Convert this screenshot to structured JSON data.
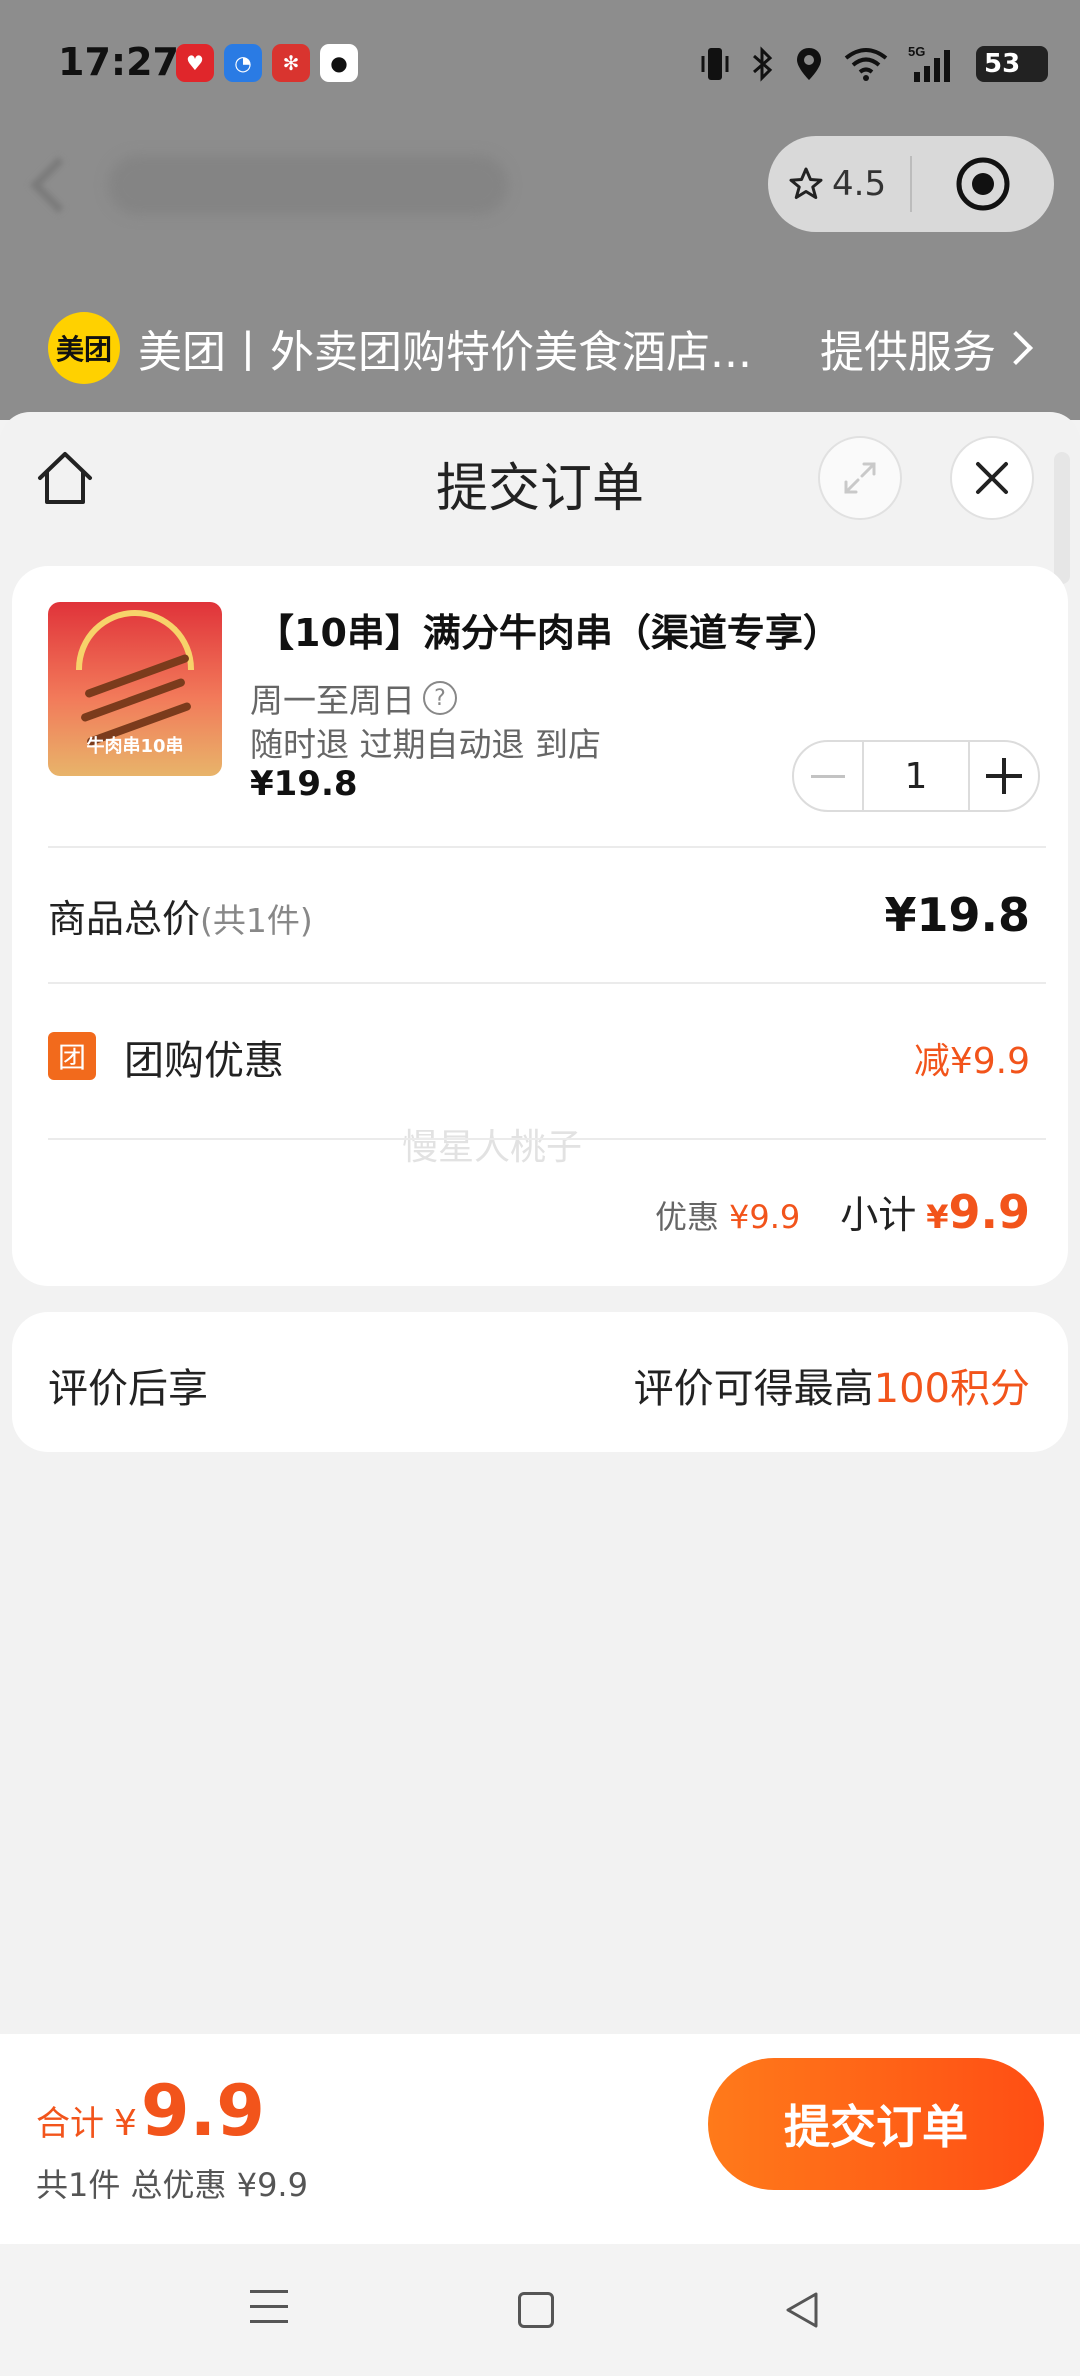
{
  "status_bar": {
    "time": "17:27",
    "network": "5G",
    "battery": "53",
    "app_icons": [
      "pinduoduo-icon",
      "app-blue-icon",
      "app-red-icon",
      "qq-icon"
    ]
  },
  "capsule": {
    "rating": "4.5"
  },
  "provider": {
    "logo_text": "美团",
    "name": "美团丨外卖团购特价美食酒店...",
    "service_label": "提供服务"
  },
  "sheet": {
    "title": "提交订单"
  },
  "product": {
    "name": "【10串】满分牛肉串（渠道专享）",
    "validity": "周一至周日",
    "terms": "随时退 过期自动退 到店",
    "price": "¥19.8",
    "image_caption": "牛肉串10串",
    "quantity": "1"
  },
  "summary": {
    "total_label": "商品总价",
    "total_count": "(共1件)",
    "total_value": "¥19.8",
    "discount_badge": "团",
    "discount_label": "团购优惠",
    "discount_value": "减¥9.9",
    "watermark": "慢星人桃子",
    "savings_label": "优惠",
    "savings_value": "¥9.9",
    "subtotal_label": "小计",
    "subtotal_currency": "¥",
    "subtotal_value": "9.9"
  },
  "review": {
    "left": "评价后享",
    "right_prefix": "评价可得最高",
    "right_accent": "100积分"
  },
  "bottom": {
    "total_label": "合计",
    "currency": "¥",
    "total_amount": "9.9",
    "total_sub": "共1件 总优惠 ¥9.9",
    "submit_label": "提交订单"
  },
  "colors": {
    "accent": "#f2541b",
    "button_start": "#ff7a1a",
    "button_end": "#ff4e14",
    "meituan_yellow": "#ffd100"
  }
}
